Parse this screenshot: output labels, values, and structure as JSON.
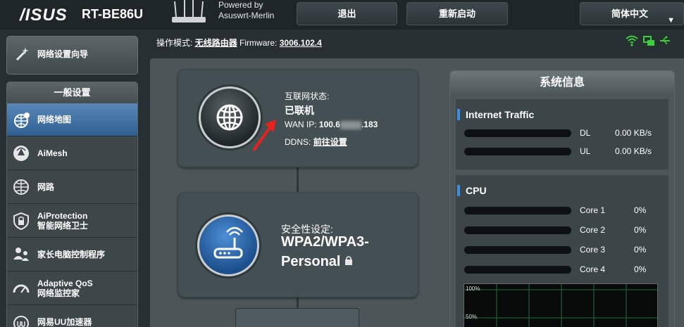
{
  "header": {
    "logo": "/ISUS",
    "model": "RT-BE86U",
    "powered_line1": "Powered by",
    "powered_line2": "Asuswrt-Merlin",
    "logout": "退出",
    "reboot": "重新启动",
    "language": "简体中文"
  },
  "subheader": {
    "mode_label": "操作模式:",
    "mode_value": "无线路由器",
    "firmware_label": "Firmware:",
    "firmware_value": "3006.102.4"
  },
  "sidebar": {
    "qis_label": "网络设置向导",
    "section_title": "一般设置",
    "items": [
      {
        "label": "网络地图",
        "icon": "network-map-icon"
      },
      {
        "label": "AiMesh",
        "icon": "aimesh-icon"
      },
      {
        "label": "网路",
        "icon": "globe-icon"
      },
      {
        "label": "AiProtection",
        "label2": "智能网络卫士",
        "icon": "shield-icon"
      },
      {
        "label": "家长电脑控制程序",
        "icon": "parental-icon"
      },
      {
        "label": "Adaptive QoS",
        "label2": "网络监控家",
        "icon": "gauge-icon"
      },
      {
        "label": "网易UU加速器",
        "icon": "uu-icon"
      }
    ]
  },
  "internet": {
    "status_label": "互联网状态:",
    "status_value": "已联机",
    "wan_label": "WAN IP:",
    "wan_value_a": "100.6",
    "wan_value_b": ".183",
    "ddns_label": "DDNS:",
    "ddns_link": "前往设置"
  },
  "security": {
    "label": "安全性设定:",
    "value_line1": "WPA2/WPA3-",
    "value_line2": "Personal"
  },
  "sysinfo": {
    "title": "系统信息",
    "traffic_title": "Internet Traffic",
    "dl_label": "DL",
    "dl_value": "0.00 KB/s",
    "ul_label": "UL",
    "ul_value": "0.00 KB/s",
    "cpu_title": "CPU",
    "cores": [
      {
        "label": "Core 1",
        "value": "0%"
      },
      {
        "label": "Core 2",
        "value": "0%"
      },
      {
        "label": "Core 3",
        "value": "0%"
      },
      {
        "label": "Core 4",
        "value": "0%"
      }
    ],
    "graph_top": "100%",
    "graph_mid": "50%"
  },
  "colors": {
    "accent_blue": "#3a8ee8",
    "wifi_green": "#3bd13b",
    "arrow_red": "#e8231d"
  }
}
